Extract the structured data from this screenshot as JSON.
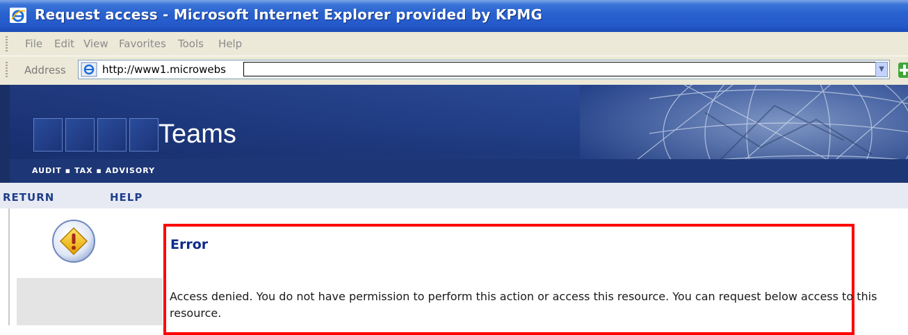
{
  "window": {
    "title": "Request access - Microsoft Internet Explorer provided by KPMG"
  },
  "menu": {
    "items": [
      "File",
      "Edit",
      "View",
      "Favorites",
      "Tools",
      "Help"
    ]
  },
  "address_bar": {
    "label": "Address",
    "url": "http://www1.microwebs"
  },
  "banner": {
    "app_name": "Teams",
    "tagline": "AUDIT ▪ TAX ▪ ADVISORY"
  },
  "nav": {
    "return_label": "RETURN",
    "help_label": "HELP"
  },
  "error": {
    "title": "Error",
    "message": "Access denied. You do not have permission to perform this action or access this resource. You can request below access to this resource."
  },
  "colors": {
    "title_bar": "#2459c9",
    "banner": "#213e86",
    "nav_text": "#1f3e8a",
    "highlight_box": "#ff0000"
  }
}
